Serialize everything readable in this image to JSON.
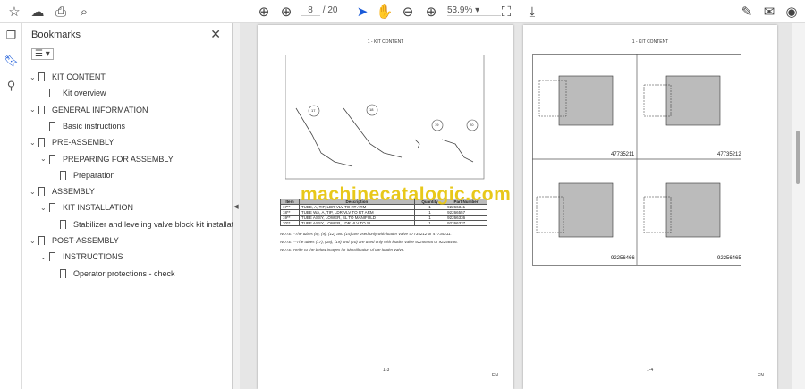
{
  "toolbar": {
    "page_current": "8",
    "page_total": "/ 20",
    "zoom": "53.9%"
  },
  "sidebar": {
    "title": "Bookmarks",
    "items": [
      {
        "label": "KIT CONTENT",
        "level": 0,
        "expanded": true
      },
      {
        "label": "Kit overview",
        "level": 1
      },
      {
        "label": "GENERAL INFORMATION",
        "level": 0,
        "expanded": true
      },
      {
        "label": "Basic instructions",
        "level": 1
      },
      {
        "label": "PRE-ASSEMBLY",
        "level": 0,
        "expanded": true
      },
      {
        "label": "PREPARING FOR ASSEMBLY",
        "level": 1,
        "expanded": true
      },
      {
        "label": "Preparation",
        "level": 2
      },
      {
        "label": "ASSEMBLY",
        "level": 0,
        "expanded": true
      },
      {
        "label": "KIT INSTALLATION",
        "level": 1,
        "expanded": true
      },
      {
        "label": "Stabilizer and leveling valve block kit installation",
        "level": 2
      },
      {
        "label": "POST-ASSEMBLY",
        "level": 0,
        "expanded": true
      },
      {
        "label": "INSTRUCTIONS",
        "level": 1,
        "expanded": true
      },
      {
        "label": "Operator protections - check",
        "level": 2
      }
    ]
  },
  "page1": {
    "header": "1 - KIT CONTENT",
    "callouts": [
      "17",
      "18",
      "19",
      "20"
    ],
    "table": {
      "headers": [
        "Item",
        "Description",
        "Quantity",
        "Part Number"
      ],
      "rows": [
        [
          "17**",
          "TUBE, A, TIP, LDR VLV TO RT ARM",
          "1",
          "92266341"
        ],
        [
          "18**",
          "TUBE WA, A, TIP, LDR VLV TO RT ARM",
          "1",
          "92266557"
        ],
        [
          "19**",
          "TUBE ASSY, LOWER, SL TO MANIFOLD",
          "1",
          "92266336"
        ],
        [
          "20**",
          "TUBE ASSY, LOWER, LDR VLV TO SL",
          "1",
          "92266337"
        ]
      ]
    },
    "notes": [
      "NOTE: *The tubes (8), (9), (12) and (15) are used only with loader valve 47735212 or 47735211.",
      "NOTE: **The tubes (17), (18), (19) and (20) are used only with loader valve 92256465 or 92256466.",
      "NOTE: Refer to the below images for identification of the loader valve."
    ],
    "footer": "1-3",
    "footer_right": "EN"
  },
  "page2": {
    "header": "1 - KIT CONTENT",
    "labels": [
      "47735211",
      "47735212",
      "92256466",
      "92256465"
    ],
    "footer": "1-4",
    "footer_right": "EN"
  },
  "watermark": "machinecatalogic.com"
}
